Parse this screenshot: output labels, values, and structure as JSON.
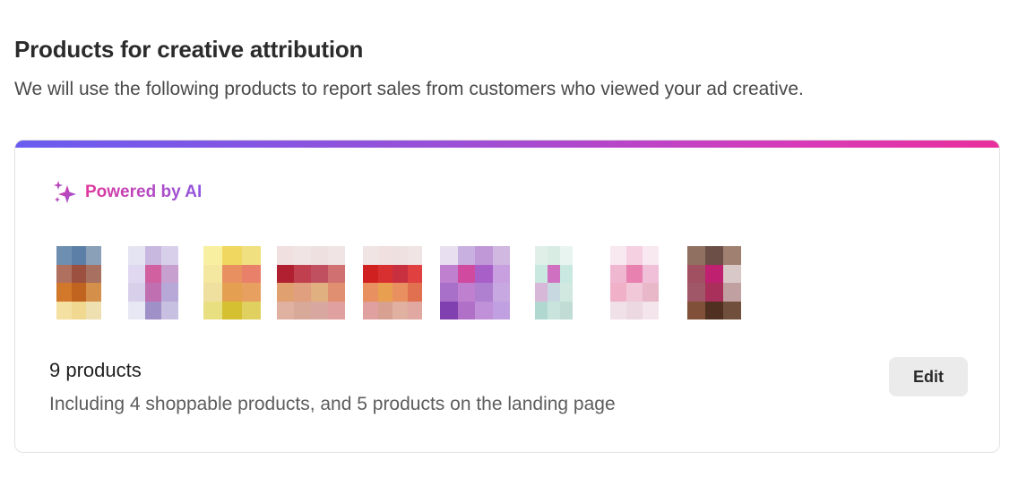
{
  "header": {
    "title": "Products for creative attribution",
    "subtitle": "We will use the following products to report sales from customers who viewed your ad creative."
  },
  "card": {
    "accent_gradient": [
      "#6a5cf0",
      "#9b4fd6",
      "#d83ab8",
      "#e82f9c"
    ],
    "ai_badge": {
      "icon": "sparkles-icon",
      "label": "Powered by AI"
    },
    "products": [
      {
        "name": "product-thumbnail-1",
        "cols": 3,
        "colors": [
          "#6f8fb0",
          "#5c7fa8",
          "#8aa0b8",
          "#b07060",
          "#9c5040",
          "#a77060",
          "#d2782a",
          "#c06420",
          "#d4904a",
          "#f4e0a0",
          "#f0d890",
          "#eee0b0"
        ]
      },
      {
        "name": "product-thumbnail-2",
        "cols": 3,
        "colors": [
          "#e4e4f2",
          "#c8b8e0",
          "#d8d0ea",
          "#e0d8f0",
          "#d060a0",
          "#c8a0d0",
          "#d8d0ea",
          "#c070b0",
          "#b8a8d8",
          "#e8e8f4",
          "#a090c8",
          "#c8c0e0"
        ]
      },
      {
        "name": "product-thumbnail-3",
        "cols": 3,
        "colors": [
          "#f8f0a0",
          "#f0d860",
          "#f0e080",
          "#f4e8a0",
          "#e89060",
          "#e8806a",
          "#f0e0a0",
          "#e4a050",
          "#e8a060",
          "#e8e080",
          "#d4c030",
          "#e0d060"
        ]
      },
      {
        "name": "product-thumbnail-4",
        "cols": 4,
        "colors": [
          "#f0e0e0",
          "#f0e4e4",
          "#eee0e0",
          "#f0e4e4",
          "#b02030",
          "#c04050",
          "#c05060",
          "#d07070",
          "#e0a070",
          "#e0a080",
          "#e0b080",
          "#e09070",
          "#e0b0a0",
          "#d8a898",
          "#d8a8a0",
          "#e0a0a0"
        ]
      },
      {
        "name": "product-thumbnail-5",
        "cols": 4,
        "colors": [
          "#f0e4e4",
          "#f0e0e0",
          "#eee0e0",
          "#f0e4e4",
          "#d02020",
          "#d83030",
          "#c83040",
          "#e04040",
          "#e89060",
          "#e8a050",
          "#e89060",
          "#e07050",
          "#e0a0a0",
          "#d8a090",
          "#e0b0a0",
          "#e0a8a0"
        ]
      },
      {
        "name": "product-thumbnail-6",
        "cols": 4,
        "colors": [
          "#e8e0f0",
          "#c8b0e0",
          "#c098d8",
          "#d0b8e0",
          "#c080d0",
          "#d04aa0",
          "#a860c8",
          "#c8a0e0",
          "#a870c8",
          "#c080d0",
          "#b080d0",
          "#c8a8e0",
          "#8040b0",
          "#b070c8",
          "#c090d8",
          "#c0a0e0"
        ]
      },
      {
        "name": "product-thumbnail-7",
        "cols": 3,
        "colors": [
          "#e0f0e8",
          "#d8ece4",
          "#e8f4f0",
          "#c8e8e0",
          "#d070c0",
          "#c8e8e0",
          "#d8b8d8",
          "#c8d8e0",
          "#d0e8e0",
          "#b0d8d0",
          "#c8e4dc",
          "#c0dcd4"
        ]
      },
      {
        "name": "product-thumbnail-8",
        "cols": 3,
        "colors": [
          "#f8e8f0",
          "#f4d0e0",
          "#f8e8f0",
          "#f0b8d0",
          "#e880b0",
          "#f0c0d8",
          "#f0b0c8",
          "#f0c8d8",
          "#e8b8c8",
          "#f0e0e8",
          "#ecd8e0",
          "#f4e4ec"
        ]
      },
      {
        "name": "product-thumbnail-9",
        "cols": 3,
        "colors": [
          "#907060",
          "#6c5048",
          "#a08070",
          "#a05060",
          "#c02070",
          "#d8c8c8",
          "#a05868",
          "#a8305a",
          "#c0a0a0",
          "#805038",
          "#503020",
          "#70503c"
        ]
      }
    ],
    "count_label": "9 products",
    "description": "Including 4 shoppable products, and 5 products on the landing page",
    "edit_label": "Edit"
  }
}
